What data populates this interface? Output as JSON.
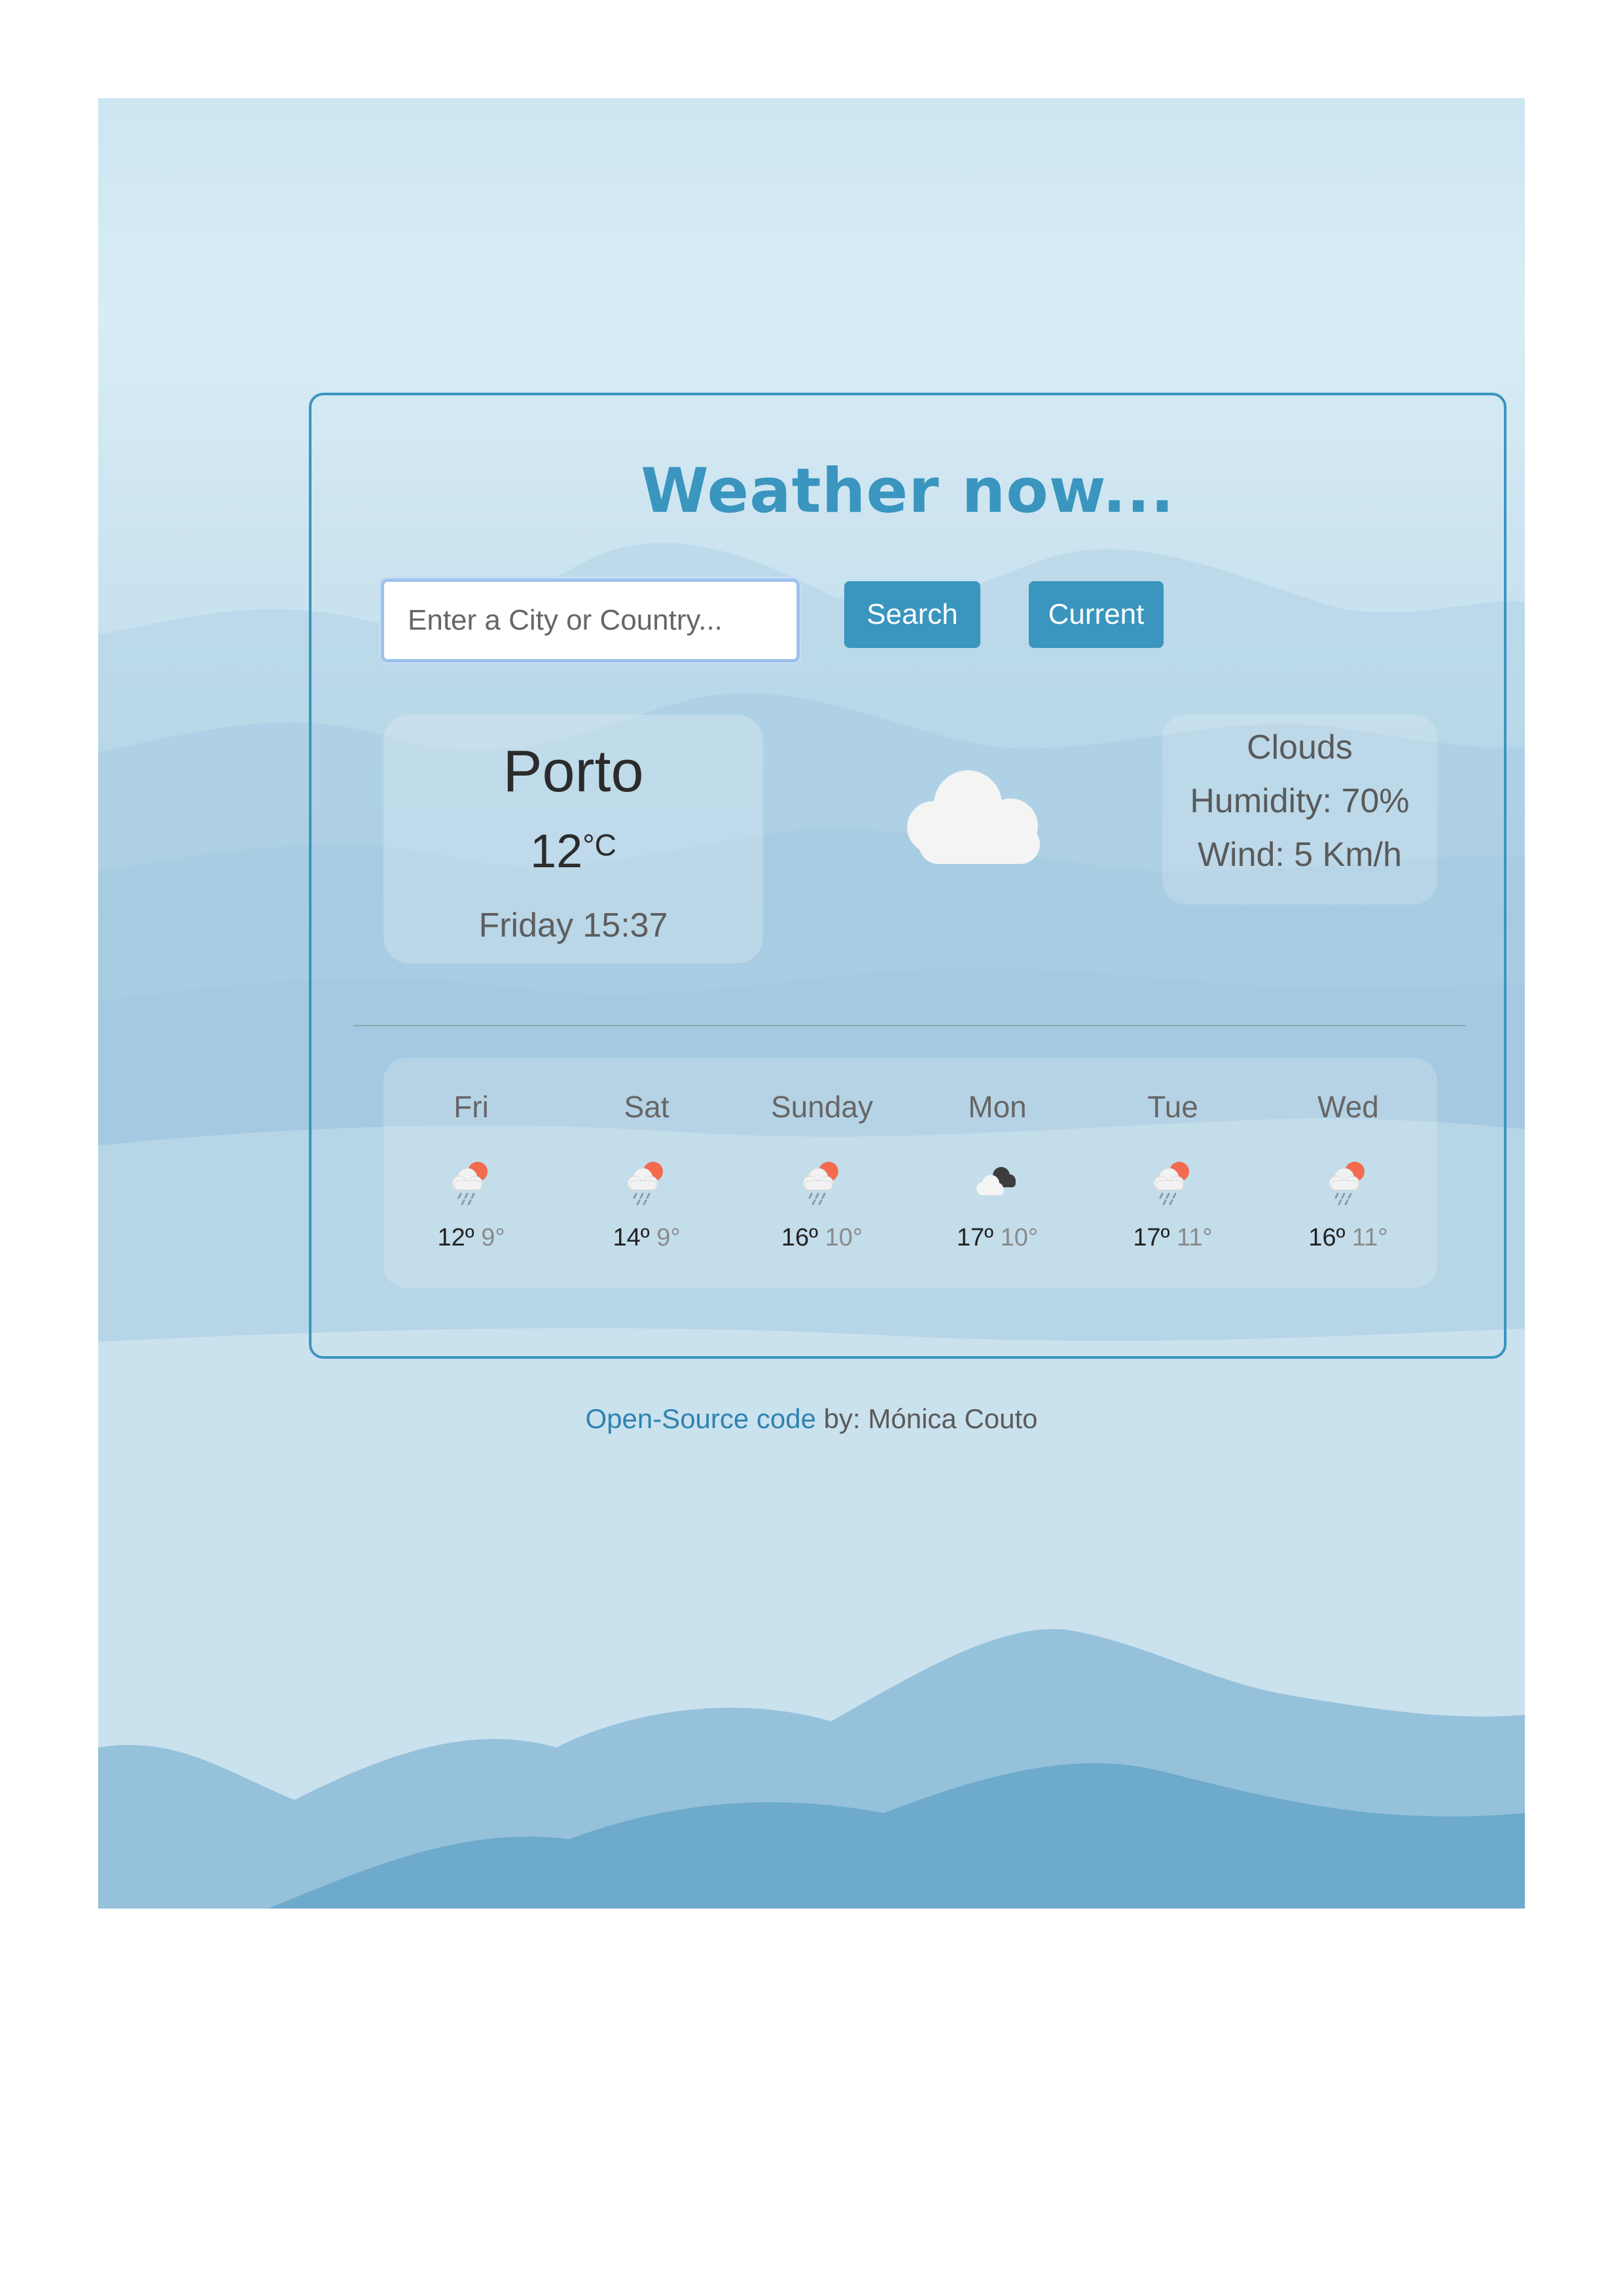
{
  "header": {
    "title": "Weather now..."
  },
  "search": {
    "placeholder": "Enter a City or Country...",
    "value": "",
    "search_label": "Search",
    "current_label": "Current"
  },
  "current": {
    "city": "Porto",
    "temperature": "12",
    "unit": "°C",
    "datetime": "Friday 15:37",
    "icon": "cloud-icon",
    "description": "Clouds",
    "humidity": "Humidity: 70%",
    "wind": "Wind: 5 Km/h"
  },
  "forecast": [
    {
      "day": "Fri",
      "max": "12º",
      "min": "9°",
      "icon": "rain-sun-icon"
    },
    {
      "day": "Sat",
      "max": "14º",
      "min": "9°",
      "icon": "rain-sun-icon"
    },
    {
      "day": "Sunday",
      "max": "16º",
      "min": "10°",
      "icon": "rain-sun-icon"
    },
    {
      "day": "Mon",
      "max": "17º",
      "min": "10°",
      "icon": "dark-clouds-icon"
    },
    {
      "day": "Tue",
      "max": "17º",
      "min": "11°",
      "icon": "rain-sun-icon"
    },
    {
      "day": "Wed",
      "max": "16º",
      "min": "11°",
      "icon": "rain-sun-icon"
    }
  ],
  "footer": {
    "link_text": "Open-Source code",
    "by_text": " by: Mónica Couto"
  },
  "colors": {
    "accent": "#3a95bf",
    "link": "#2f83b0",
    "sun": "#f26b4e"
  }
}
